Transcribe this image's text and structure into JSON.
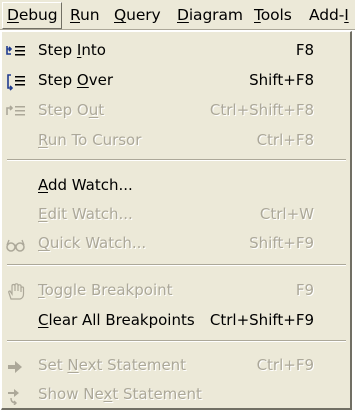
{
  "menubar": {
    "items": [
      {
        "label": "Debug",
        "mnemonic": "D",
        "rest": "ebug"
      },
      {
        "label": "Run",
        "mnemonic": "R",
        "rest": "un"
      },
      {
        "label": "Query",
        "mnemonic": "Q",
        "rest": "uery"
      },
      {
        "label": "Diagram",
        "mnemonic": "D",
        "rest": "iagram"
      },
      {
        "label": "Tools",
        "mnemonic": "T",
        "rest": "ools"
      },
      {
        "label": "Add-In",
        "pre": "Add-",
        "mnemonic": "I"
      }
    ]
  },
  "menu": {
    "items": [
      {
        "pre": "Step ",
        "mnemonic": "I",
        "post": "nto",
        "shortcut": "F8",
        "icon": "step-into-icon",
        "enabled": true
      },
      {
        "pre": "Step ",
        "mnemonic": "O",
        "post": "ver",
        "shortcut": "Shift+F8",
        "icon": "step-over-icon",
        "enabled": true
      },
      {
        "pre": "Step O",
        "mnemonic": "u",
        "post": "t",
        "shortcut": "Ctrl+Shift+F8",
        "icon": "step-out-icon",
        "enabled": false
      },
      {
        "pre": "",
        "mnemonic": "R",
        "post": "un To Cursor",
        "shortcut": "Ctrl+F8",
        "icon": "",
        "enabled": false
      },
      {
        "pre": "",
        "mnemonic": "A",
        "post": "dd Watch...",
        "shortcut": "",
        "icon": "",
        "enabled": true
      },
      {
        "pre": "",
        "mnemonic": "E",
        "post": "dit Watch...",
        "shortcut": "Ctrl+W",
        "icon": "",
        "enabled": false
      },
      {
        "pre": "",
        "mnemonic": "Q",
        "post": "uick Watch...",
        "shortcut": "Shift+F9",
        "icon": "glasses-icon",
        "enabled": false
      },
      {
        "pre": "",
        "mnemonic": "T",
        "post": "oggle Breakpoint",
        "shortcut": "F9",
        "icon": "hand-icon",
        "enabled": false
      },
      {
        "pre": "",
        "mnemonic": "C",
        "post": "lear All Breakpoints",
        "shortcut": "Ctrl+Shift+F9",
        "icon": "",
        "enabled": true
      },
      {
        "pre": "Set ",
        "mnemonic": "N",
        "post": "ext Statement",
        "shortcut": "Ctrl+F9",
        "icon": "arrow-right-icon",
        "enabled": false
      },
      {
        "pre": "Show Ne",
        "mnemonic": "x",
        "post": "t Statement",
        "shortcut": "",
        "icon": "show-next-icon",
        "enabled": false
      }
    ]
  },
  "colors": {
    "menu_bg": "#ece9d8",
    "disabled_text": "#aca899",
    "icon_blue": "#1f3b8f"
  }
}
